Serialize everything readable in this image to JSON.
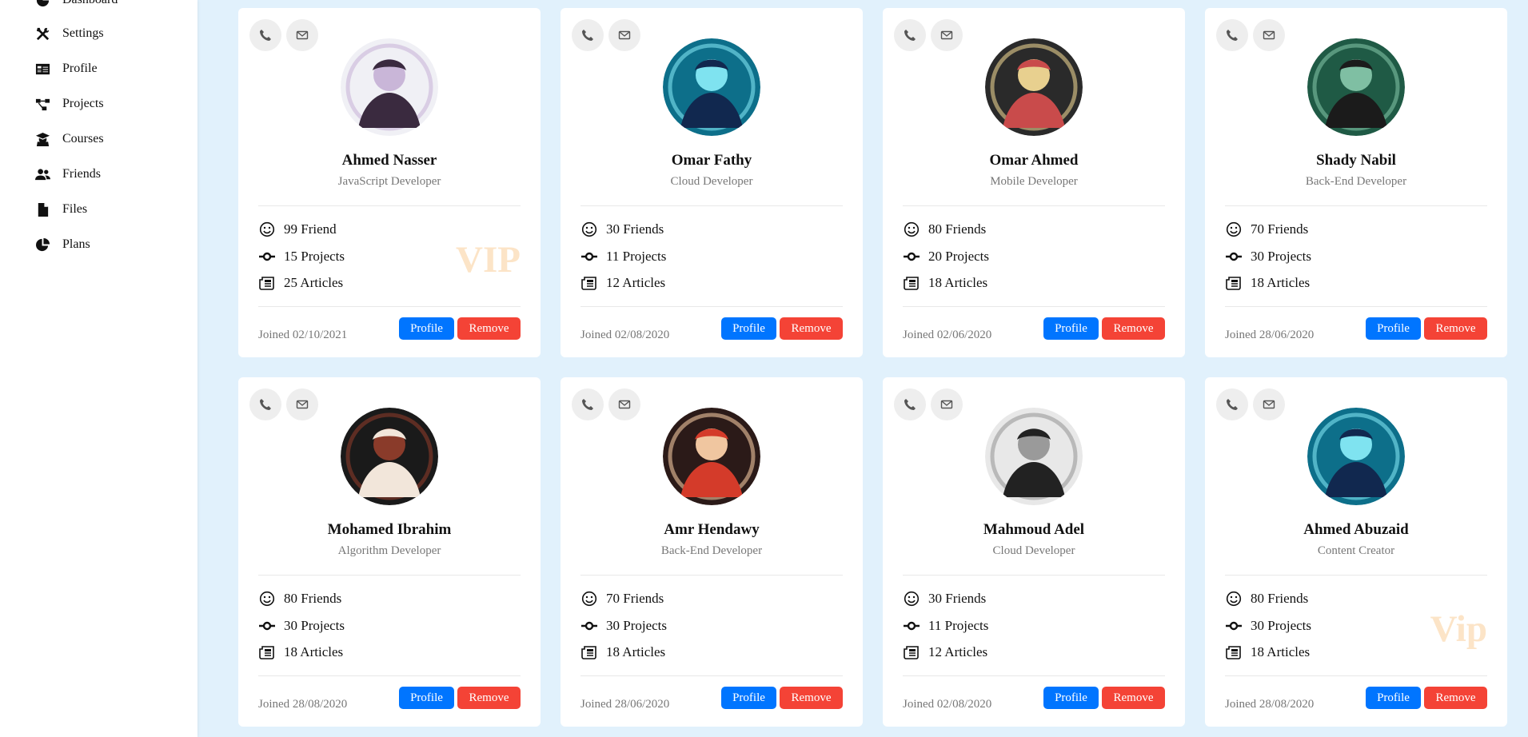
{
  "sidebar": {
    "items": [
      {
        "label": "Dashboard",
        "icon": "dashboard-icon"
      },
      {
        "label": "Settings",
        "icon": "settings-icon"
      },
      {
        "label": "Profile",
        "icon": "profile-icon"
      },
      {
        "label": "Projects",
        "icon": "projects-icon"
      },
      {
        "label": "Courses",
        "icon": "courses-icon"
      },
      {
        "label": "Friends",
        "icon": "friends-icon"
      },
      {
        "label": "Files",
        "icon": "files-icon"
      },
      {
        "label": "Plans",
        "icon": "plans-icon"
      }
    ]
  },
  "colors": {
    "accent": "#0075ff",
    "danger": "#f44336",
    "background": "#e1f1fc",
    "vip": "#fce4c7"
  },
  "buttons": {
    "profile": "Profile",
    "remove": "Remove"
  },
  "cards": [
    {
      "name": "Ahmed Nasser",
      "role": "JavaScript Developer",
      "friends": "99 Friend",
      "projects": "15 Projects",
      "articles": "25 Articles",
      "joined": "Joined 02/10/2021",
      "badge": "VIP"
    },
    {
      "name": "Omar Fathy",
      "role": "Cloud Developer",
      "friends": "30 Friends",
      "projects": "11 Projects",
      "articles": "12 Articles",
      "joined": "Joined 02/08/2020",
      "badge": ""
    },
    {
      "name": "Omar Ahmed",
      "role": "Mobile Developer",
      "friends": "80 Friends",
      "projects": "20 Projects",
      "articles": "18 Articles",
      "joined": "Joined 02/06/2020",
      "badge": ""
    },
    {
      "name": "Shady Nabil",
      "role": "Back-End Developer",
      "friends": "70 Friends",
      "projects": "30 Projects",
      "articles": "18 Articles",
      "joined": "Joined 28/06/2020",
      "badge": ""
    },
    {
      "name": "Mohamed Ibrahim",
      "role": "Algorithm Developer",
      "friends": "80 Friends",
      "projects": "30 Projects",
      "articles": "18 Articles",
      "joined": "Joined 28/08/2020",
      "badge": ""
    },
    {
      "name": "Amr Hendawy",
      "role": "Back-End Developer",
      "friends": "70 Friends",
      "projects": "30 Projects",
      "articles": "18 Articles",
      "joined": "Joined 28/06/2020",
      "badge": ""
    },
    {
      "name": "Mahmoud Adel",
      "role": "Cloud Developer",
      "friends": "30 Friends",
      "projects": "11 Projects",
      "articles": "12 Articles",
      "joined": "Joined 02/08/2020",
      "badge": ""
    },
    {
      "name": "Ahmed Abuzaid",
      "role": "Content Creator",
      "friends": "80 Friends",
      "projects": "30 Projects",
      "articles": "18 Articles",
      "joined": "Joined 28/08/2020",
      "badge": "Vip"
    }
  ]
}
